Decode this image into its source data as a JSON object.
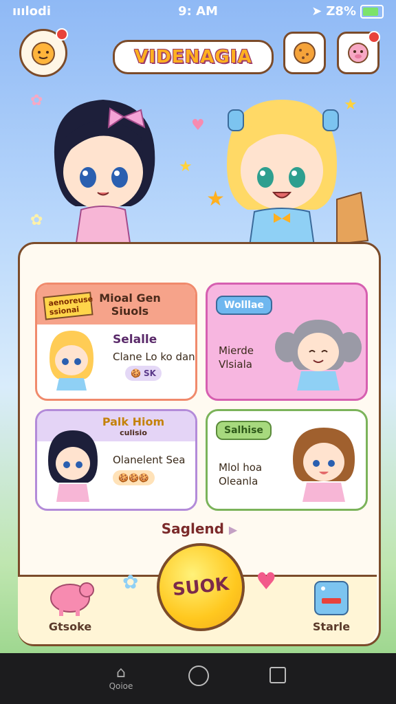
{
  "status_bar": {
    "signal": "ııılodi",
    "time": "9: AM",
    "battery_pct": "Z8%",
    "battery_level": 0.85
  },
  "app": {
    "logo_text": "VIDENAGIA"
  },
  "main": {
    "cards": [
      {
        "tag": "aenoreuse ssionai",
        "header": "Mioal Gen Siuols",
        "title": "Selalle",
        "desc": "Clane Lo ko dan",
        "pill": "SK"
      },
      {
        "chip": "Wolllae",
        "desc": "Mierde Vlsiala"
      },
      {
        "header": "Palk Hiom",
        "sub": "culisio",
        "desc": "Olanelent Sea"
      },
      {
        "chip": "Salhise",
        "desc": "Mlol hoa Oleanla"
      }
    ],
    "section_label": "Saglend",
    "section_arrow": "▶"
  },
  "bottom_nav": {
    "left_label": "Gtsoke",
    "center_label": "SUOK",
    "right_label": "Starle"
  },
  "system_nav": {
    "home_label": "Qoioe"
  },
  "colors": {
    "card1": "#f08a6c",
    "card2": "#d65fb0",
    "card3": "#b38bd9",
    "card4": "#7bb35a",
    "accent": "#ffc81f"
  }
}
